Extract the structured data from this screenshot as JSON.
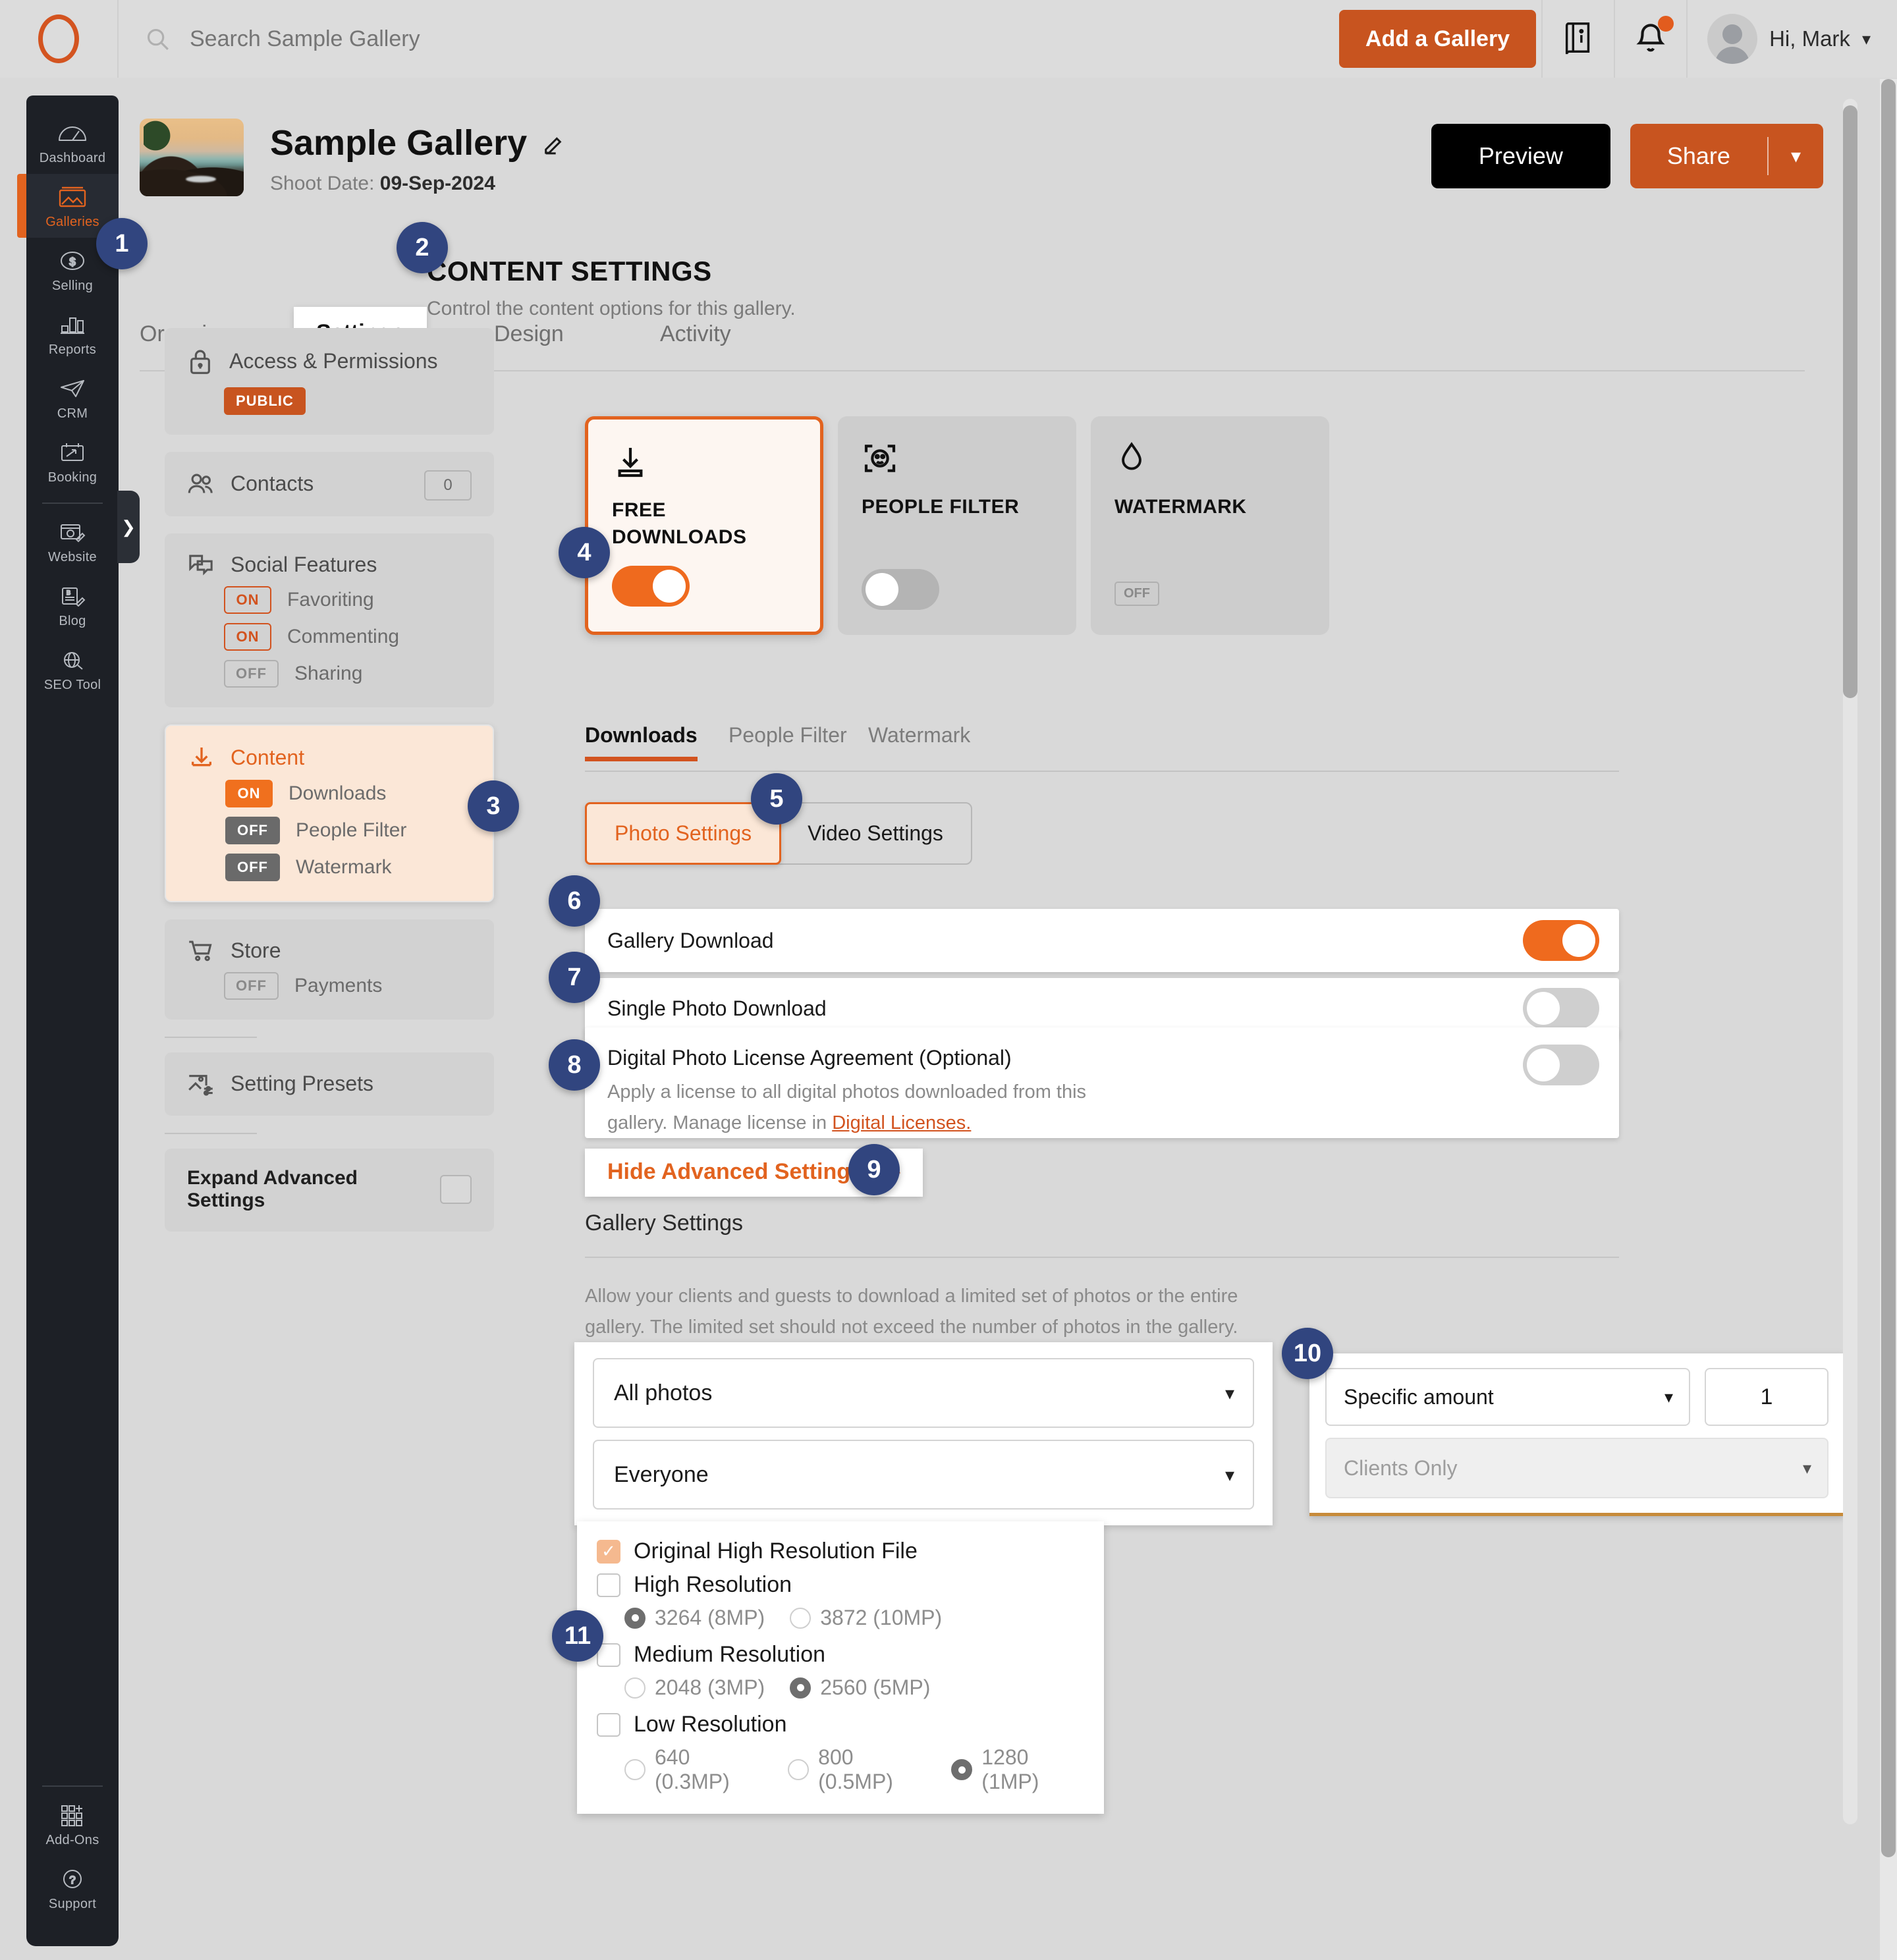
{
  "topbar": {
    "logo": "ring-logo",
    "search_placeholder": "Search Sample Gallery",
    "add_gallery_label": "Add a Gallery",
    "greeting": "Hi, Mark",
    "icons": {
      "search": "search-icon",
      "guide": "book-info-icon",
      "bell": "bell-icon",
      "avatar": "user-avatar-icon",
      "chevron": "chevron-down-icon"
    }
  },
  "leftnav": {
    "items": [
      {
        "label": "Dashboard",
        "icon": "gauge-icon",
        "active": false
      },
      {
        "label": "Galleries",
        "icon": "image-icon",
        "active": true
      },
      {
        "label": "Selling",
        "icon": "dollar-circle-icon",
        "active": false
      },
      {
        "label": "Reports",
        "icon": "bar-chart-icon",
        "active": false
      },
      {
        "label": "CRM",
        "icon": "paper-plane-icon",
        "active": false
      },
      {
        "label": "Booking",
        "icon": "calendar-arrow-icon",
        "active": false
      },
      {
        "label": "Website",
        "icon": "browser-pencil-icon",
        "active": false
      },
      {
        "label": "Blog",
        "icon": "document-pencil-icon",
        "active": false
      },
      {
        "label": "SEO Tool",
        "icon": "globe-search-icon",
        "active": false
      }
    ],
    "bottom": [
      {
        "label": "Add-Ons",
        "icon": "grid-plus-icon"
      },
      {
        "label": "Support",
        "icon": "question-circle-icon"
      }
    ],
    "expander_icon": "chevron-right-icon"
  },
  "gallery": {
    "title": "Sample Gallery",
    "edit_icon": "pencil-icon",
    "shoot_date_label": "Shoot Date:",
    "shoot_date_value": "09-Sep-2024",
    "preview_label": "Preview",
    "share_label": "Share",
    "share_caret": "chevron-down-icon",
    "tabs": [
      {
        "label": "Organize",
        "active": false
      },
      {
        "label": "Settings",
        "active": true
      },
      {
        "label": "Design",
        "active": false
      },
      {
        "label": "Activity",
        "active": false
      }
    ]
  },
  "content_settings": {
    "heading": "CONTENT SETTINGS",
    "subheading": "Control the content options for this gallery."
  },
  "settings_list": [
    {
      "title": "Access & Permissions",
      "icon": "lock-icon",
      "active": false,
      "pill": "PUBLIC",
      "subitems": []
    },
    {
      "title": "Contacts",
      "icon": "people-icon",
      "active": false,
      "count": "0",
      "subitems": []
    },
    {
      "title": "Social Features",
      "icon": "chat-bubbles-icon",
      "active": false,
      "subitems": [
        {
          "state": "ON",
          "label": "Favoriting"
        },
        {
          "state": "ON",
          "label": "Commenting"
        },
        {
          "state": "OFF",
          "label": "Sharing"
        }
      ]
    },
    {
      "title": "Content",
      "icon": "download-icon",
      "active": true,
      "subitems": [
        {
          "state": "ON",
          "label": "Downloads"
        },
        {
          "state": "OFF",
          "label": "People Filter"
        },
        {
          "state": "OFF",
          "label": "Watermark"
        }
      ]
    },
    {
      "title": "Store",
      "icon": "cart-icon",
      "active": false,
      "subitems": [
        {
          "state": "OFF",
          "label": "Payments"
        }
      ]
    },
    {
      "title": "Setting Presets",
      "icon": "image-sliders-icon",
      "active": false,
      "subitems": []
    }
  ],
  "expand_advanced": {
    "label": "Expand Advanced Settings",
    "checked": false
  },
  "type_cards": [
    {
      "name": "FREE DOWNLOADS",
      "icon": "download-icon",
      "selected": true,
      "toggle": "on"
    },
    {
      "name": "PEOPLE FILTER",
      "icon": "face-scan-icon",
      "selected": false,
      "toggle": "off"
    },
    {
      "name": "WATERMARK",
      "icon": "droplet-icon",
      "selected": false,
      "toggle": "off-badge",
      "off_text": "OFF"
    }
  ],
  "download_tabs": [
    {
      "label": "Downloads",
      "active": true
    },
    {
      "label": "People Filter",
      "active": false
    },
    {
      "label": "Watermark",
      "active": false
    }
  ],
  "segmented": [
    {
      "label": "Photo Settings",
      "selected": true
    },
    {
      "label": "Video Settings",
      "selected": false
    }
  ],
  "toggle_rows": [
    {
      "label": "Gallery Download",
      "state": "on"
    },
    {
      "label": "Single Photo Download",
      "state": "off"
    }
  ],
  "license_row": {
    "label": "Digital Photo License Agreement (Optional)",
    "desc_line1": "Apply a license to all digital photos downloaded from this",
    "desc_line2_pre": "gallery. Manage license in ",
    "desc_link": "Digital Licenses.",
    "state": "off"
  },
  "hide_advanced": {
    "label": "Hide Advanced Settings",
    "caret": "chevron-up-icon"
  },
  "gallery_settings": {
    "title": "Gallery Settings",
    "desc_line1": "Allow your clients and guests to download a limited set of photos or the entire",
    "desc_line2": "gallery. The limited set should not exceed the number of photos in the gallery.",
    "dropdown_photos": "All photos",
    "dropdown_audience": "Everyone",
    "dropdown_amount": "Specific amount",
    "amount_value": "1",
    "dropdown_clients": "Clients Only"
  },
  "resolutions": [
    {
      "label": "Original High Resolution File",
      "type": "checkbox",
      "checked": true,
      "options": []
    },
    {
      "label": "High Resolution",
      "type": "checkbox",
      "checked": false,
      "options": [
        {
          "label": "3264 (8MP)",
          "selected": true
        },
        {
          "label": "3872 (10MP)",
          "selected": false
        }
      ]
    },
    {
      "label": "Medium Resolution",
      "type": "checkbox",
      "checked": false,
      "options": [
        {
          "label": "2048 (3MP)",
          "selected": false
        },
        {
          "label": "2560 (5MP)",
          "selected": true
        }
      ]
    },
    {
      "label": "Low Resolution",
      "type": "checkbox",
      "checked": false,
      "options": [
        {
          "label": "640 (0.3MP)",
          "selected": false
        },
        {
          "label": "800 (0.5MP)",
          "selected": false
        },
        {
          "label": "1280 (1MP)",
          "selected": true
        }
      ]
    }
  ],
  "badges": [
    "1",
    "2",
    "3",
    "4",
    "5",
    "6",
    "7",
    "8",
    "9",
    "10",
    "11"
  ],
  "colors": {
    "accent": "#d2531f",
    "accent_bright": "#ef6a1e",
    "badge": "#31457f",
    "dark_nav": "#1d2026",
    "page_bg": "#d9d9d9"
  }
}
